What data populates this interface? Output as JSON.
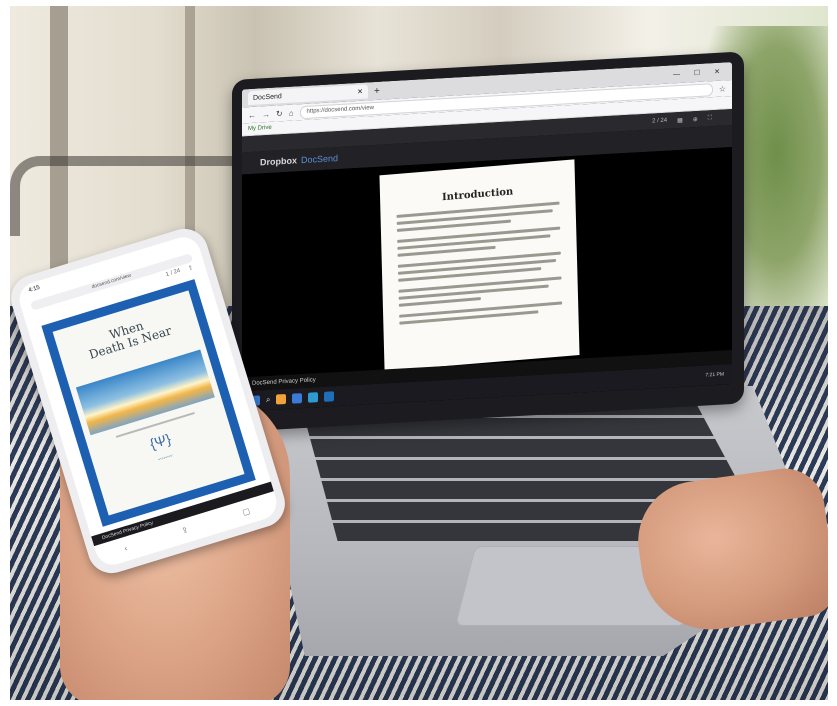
{
  "laptop": {
    "browser": {
      "tab_title": "DocSend",
      "new_tab": "+",
      "window_controls": "— ☐ ✕",
      "url": "https://docsend.com/view",
      "bookmark": "My Drive"
    },
    "viewer": {
      "page_counter": "2 / 24",
      "brand_name": "Dropbox",
      "brand_product": "DocSend",
      "document_heading": "Introduction",
      "footer_link": "DocSend Privacy Policy",
      "clock": "7:21 PM"
    }
  },
  "phone": {
    "status_time": "4:15",
    "url": "docsend.com/view",
    "page_counter": "1 / 24",
    "cover": {
      "title_line1": "When",
      "title_line2": "Death Is Near"
    },
    "footer_link": "DocSend Privacy Policy"
  },
  "icons": [
    "close-icon",
    "back-icon",
    "forward-icon",
    "reload-icon",
    "home-icon",
    "search-icon",
    "share-icon",
    "bookmark-icon",
    "windows-start-icon"
  ],
  "colors": {
    "phone_cover_border": "#1d5fb0",
    "docsend_accent": "#5b8fd6",
    "tablecloth_stripe": "#2b3a57"
  }
}
